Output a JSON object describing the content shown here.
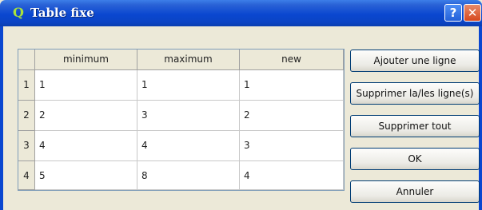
{
  "window": {
    "title": "Table fixe",
    "help_glyph": "?",
    "close_glyph": "✕",
    "app_glyph": "Q"
  },
  "table": {
    "columns": [
      "minimum",
      "maximum",
      "new"
    ],
    "rows": [
      {
        "num": "1",
        "cells": [
          "1",
          "1",
          "1"
        ]
      },
      {
        "num": "2",
        "cells": [
          "2",
          "3",
          "2"
        ]
      },
      {
        "num": "3",
        "cells": [
          "4",
          "4",
          "3"
        ]
      },
      {
        "num": "4",
        "cells": [
          "5",
          "8",
          "4"
        ]
      }
    ]
  },
  "buttons": {
    "add_row": "Ajouter une ligne",
    "delete_rows": "Supprimer la/les ligne(s)",
    "delete_all": "Supprimer tout",
    "ok": "OK",
    "cancel": "Annuler"
  },
  "colors": {
    "titlebar": "#0a47d0",
    "window_bg": "#ece9d8"
  },
  "icons": {
    "app": "qgis-icon",
    "help": "help-icon",
    "close": "close-icon"
  }
}
